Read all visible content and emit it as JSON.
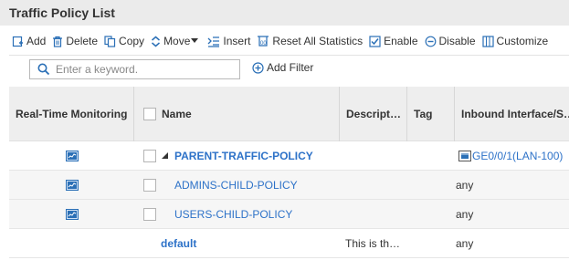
{
  "panel": {
    "title": "Traffic Policy List"
  },
  "toolbar": {
    "add": "Add",
    "delete": "Delete",
    "copy": "Copy",
    "move": "Move",
    "insert": "Insert",
    "reset": "Reset All Statistics",
    "enable": "Enable",
    "disable": "Disable",
    "customize": "Customize"
  },
  "search": {
    "placeholder": "Enter a keyword.",
    "value": ""
  },
  "filter": {
    "add_filter_label": "Add Filter"
  },
  "table": {
    "columns": {
      "monitoring": "Real-Time Monitoring",
      "name": "Name",
      "description": "Descript…",
      "tag": "Tag",
      "inbound": "Inbound Interface/S…"
    },
    "rows": [
      {
        "name": "PARENT-TRAFFIC-POLICY",
        "description": "",
        "tag": "",
        "inbound": "GE0/0/1(LAN-100)",
        "has_monitor": true,
        "has_checkbox": true,
        "expander": "▲"
      },
      {
        "name": "ADMINS-CHILD-POLICY",
        "description": "",
        "tag": "",
        "inbound": "any",
        "has_monitor": true,
        "has_checkbox": true
      },
      {
        "name": "USERS-CHILD-POLICY",
        "description": "",
        "tag": "",
        "inbound": "any",
        "has_monitor": true,
        "has_checkbox": true
      },
      {
        "name": "default",
        "description": "This is th…",
        "tag": "",
        "inbound": "any",
        "has_monitor": false,
        "has_checkbox": false
      }
    ]
  },
  "colors": {
    "link": "#2d72c8",
    "icon_blue": "#2a6fb6",
    "header_bg": "#eeeeee",
    "title_bg": "#ebebeb"
  }
}
